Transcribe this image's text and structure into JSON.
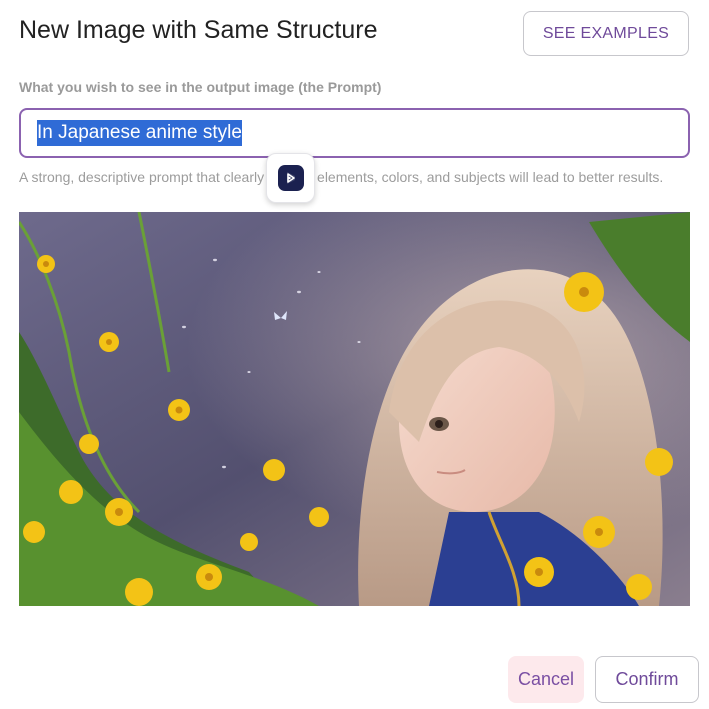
{
  "dialog": {
    "title": "New Image with Same Structure",
    "see_examples_label": "SEE EXAMPLES"
  },
  "prompt": {
    "label": "What you wish to see in the output image (the Prompt)",
    "value": "In Japanese anime style",
    "value_selected": true,
    "helper_text": "A strong, descriptive prompt that clearly defines elements, colors, and subjects will lead to better results."
  },
  "extension_badge": {
    "icon": "extension-logo-icon"
  },
  "preview_image": {
    "description_icon": "anime-girl-flowers-image"
  },
  "footer": {
    "cancel_label": "Cancel",
    "confirm_label": "Confirm"
  },
  "colors": {
    "accent": "#6f4a9a",
    "input_border": "#8b62b0",
    "selection": "#2f6bd6",
    "cancel_bg": "#fde9ec",
    "badge_logo": "#1b2150"
  }
}
